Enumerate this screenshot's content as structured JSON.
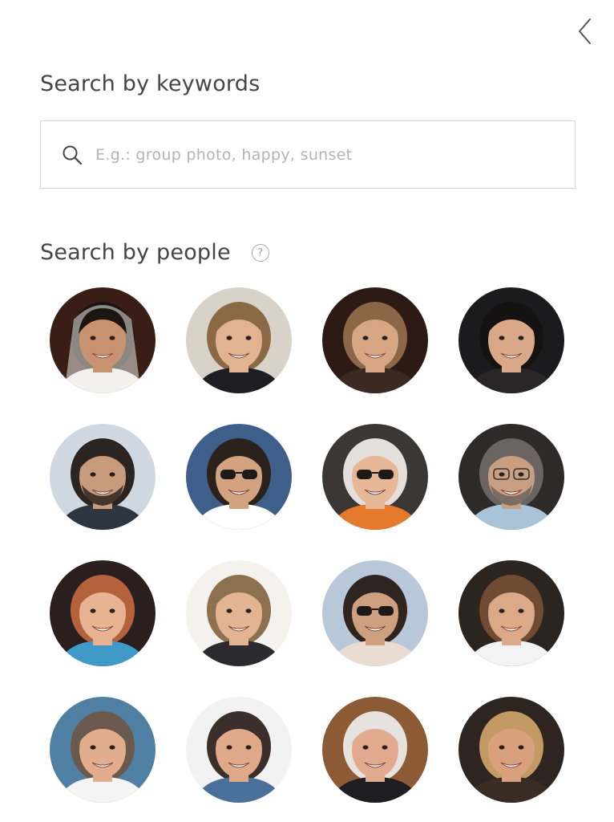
{
  "header": {
    "back_icon": "chevron-left-icon"
  },
  "keywords": {
    "title": "Search by keywords",
    "placeholder": "E.g.: group photo, happy, sunset",
    "value": "",
    "icon": "search-icon"
  },
  "people": {
    "title": "Search by people",
    "help_icon": "help-icon",
    "help_glyph": "?",
    "faces": [
      {
        "bg": "#3a1e16",
        "skin": "#c99372",
        "hair": "#1c1512",
        "clothing": "#f3f1ee",
        "veil": true
      },
      {
        "bg": "#d8d2c8",
        "skin": "#e2b390",
        "hair": "#8a6a44",
        "clothing": "#1e1e22"
      },
      {
        "bg": "#2e1a14",
        "skin": "#d6a685",
        "hair": "#8b6748",
        "clothing": "#3a2a22"
      },
      {
        "bg": "#1b1b1d",
        "skin": "#d9a888",
        "hair": "#151212",
        "clothing": "#2a2628"
      },
      {
        "bg": "#cfd8e0",
        "skin": "#c79b7c",
        "hair": "#2c2420",
        "clothing": "#2d3540",
        "beard": true
      },
      {
        "bg": "#3e5f89",
        "skin": "#d2a281",
        "hair": "#2b221c",
        "clothing": "#ffffff",
        "sunglasses": true
      },
      {
        "bg": "#3b3735",
        "skin": "#e7b897",
        "hair": "#e3dfda",
        "clothing": "#e57a2c",
        "sunglasses": true
      },
      {
        "bg": "#2e2a2a",
        "skin": "#c89f80",
        "hair": "#6b6460",
        "clothing": "#a9c3d8",
        "glasses": true,
        "beard": true
      },
      {
        "bg": "#2a1f1c",
        "skin": "#e8b393",
        "hair": "#b5613c",
        "clothing": "#3f9ac7"
      },
      {
        "bg": "#f5f1ec",
        "skin": "#e3b491",
        "hair": "#8d7050",
        "clothing": "#2a2a30"
      },
      {
        "bg": "#b9c8d8",
        "skin": "#cfa080",
        "hair": "#2e2520",
        "clothing": "#e9dcd0",
        "sunglasses": true
      },
      {
        "bg": "#2c241f",
        "skin": "#dba988",
        "hair": "#6e4b32",
        "clothing": "#f3f3f3"
      },
      {
        "bg": "#4f80a3",
        "skin": "#e1ad8d",
        "hair": "#6a5a4e",
        "clothing": "#f4f4f4"
      },
      {
        "bg": "#f2f2f2",
        "skin": "#e0a98a",
        "hair": "#3a2f2a",
        "clothing": "#4a6f98"
      },
      {
        "bg": "#8c5b36",
        "skin": "#e1a98d",
        "hair": "#e6e2de",
        "clothing": "#1d1d22"
      },
      {
        "bg": "#2f2520",
        "skin": "#d9a07d",
        "hair": "#c39a63",
        "clothing": "#3a2c25"
      }
    ]
  }
}
